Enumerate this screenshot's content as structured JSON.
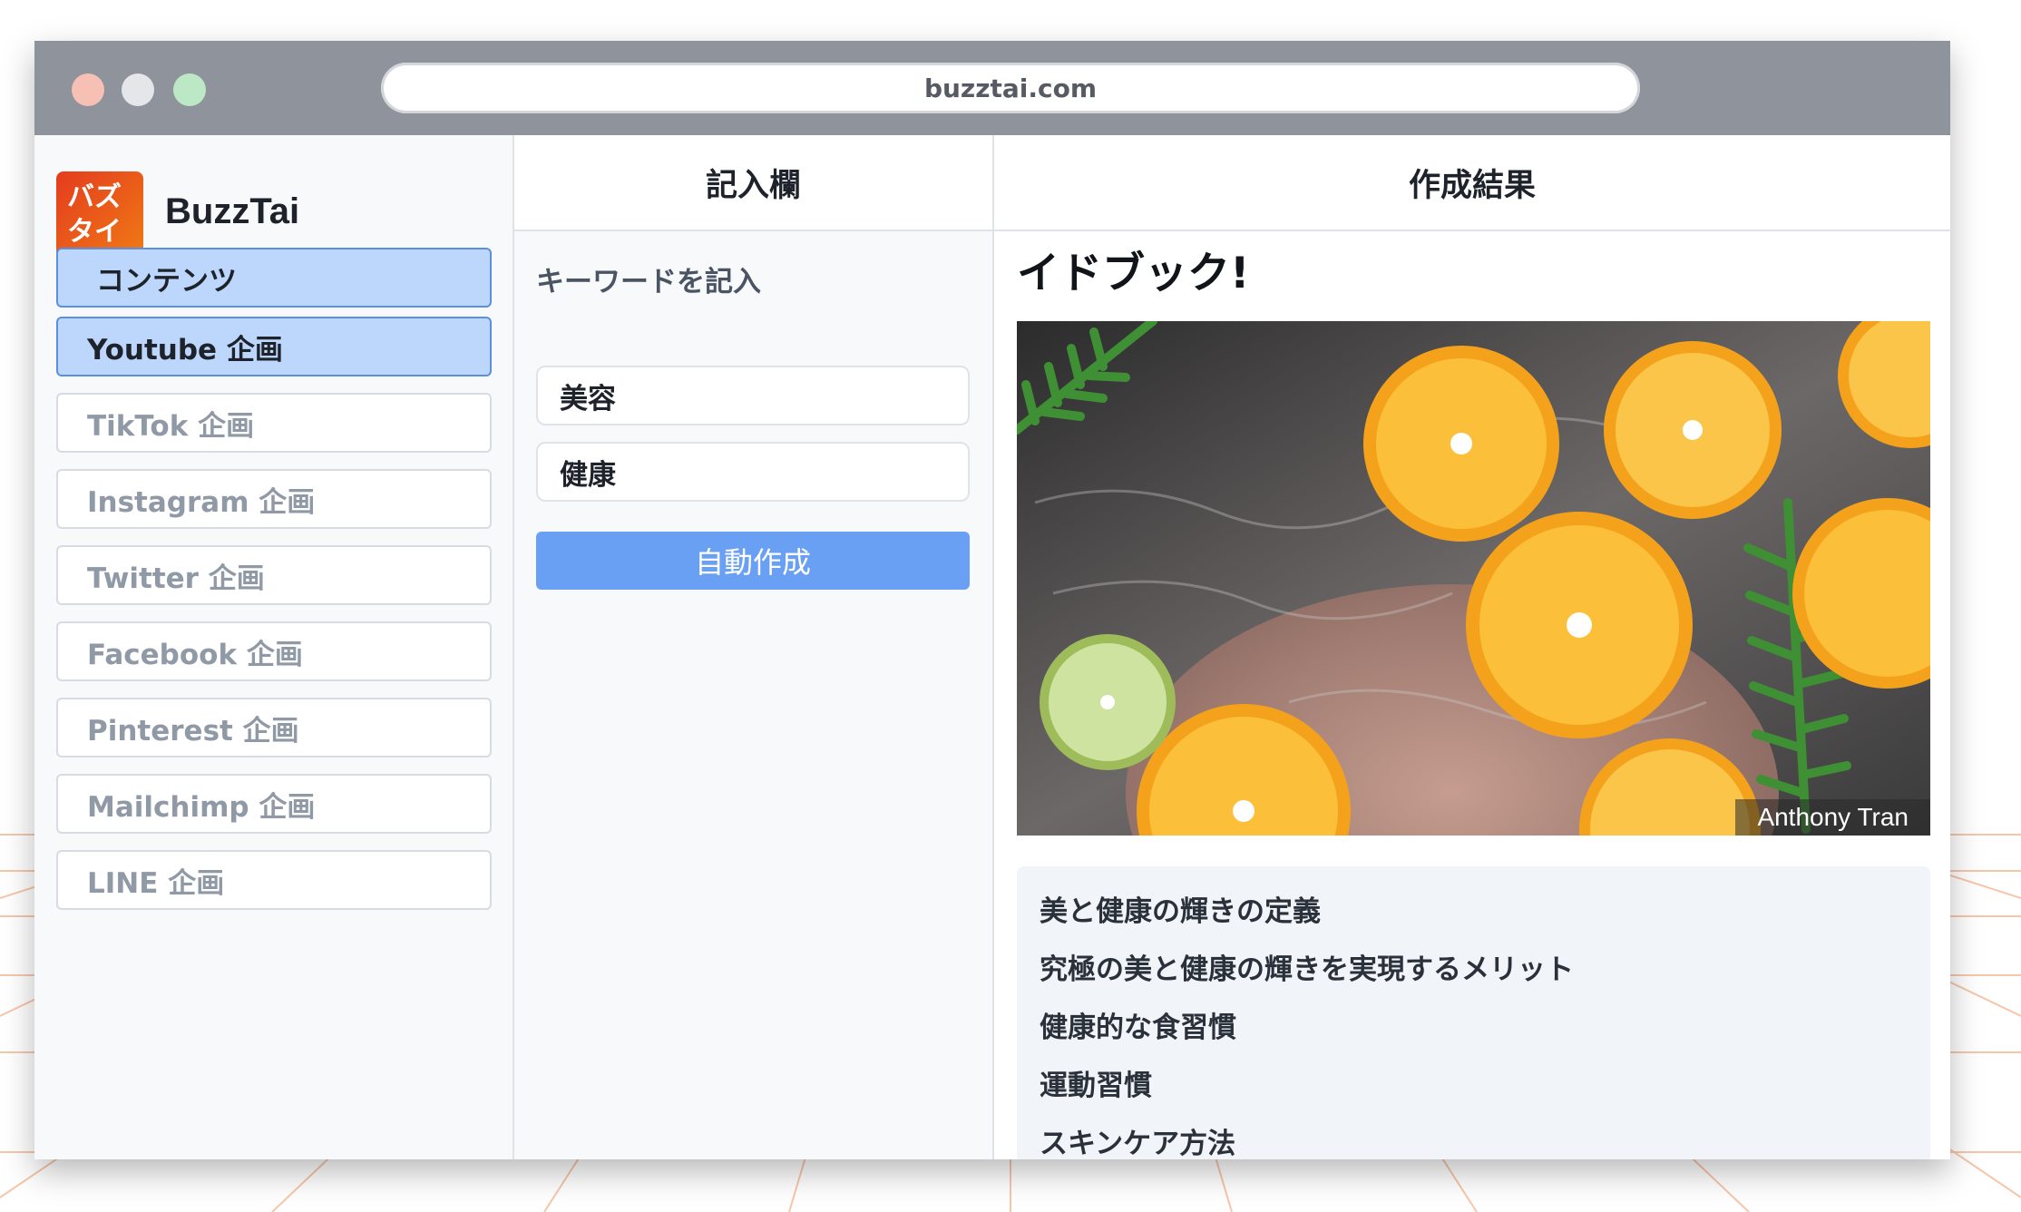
{
  "browser": {
    "url": "buzztai.com"
  },
  "sidebar": {
    "logo_line1": "バズ",
    "logo_line2": "タイ",
    "brand": "BuzzTai",
    "contents_label": "コンテンツ",
    "items": [
      {
        "label": "Youtube 企画",
        "active": true
      },
      {
        "label": "TikTok 企画",
        "active": false
      },
      {
        "label": "Instagram 企画",
        "active": false
      },
      {
        "label": "Twitter 企画",
        "active": false
      },
      {
        "label": "Facebook 企画",
        "active": false
      },
      {
        "label": "Pinterest 企画",
        "active": false
      },
      {
        "label": "Mailchimp 企画",
        "active": false
      },
      {
        "label": "LINE 企画",
        "active": false
      }
    ]
  },
  "input_panel": {
    "header": "記入欄",
    "keyword_label": "キーワードを記入",
    "keyword1": "美容",
    "keyword2": "健康",
    "generate_button": "自動作成"
  },
  "result_panel": {
    "header": "作成結果",
    "title": "イドブック!",
    "photo_credit": "Anthony Tran",
    "outline": [
      "美と健康の輝きの定義",
      "究極の美と健康の輝きを実現するメリット",
      "健康的な食習慣",
      "運動習慣",
      "スキンケア方法"
    ]
  },
  "colors": {
    "accent": "#6aa0f3",
    "active_nav_bg": "#bcd7fb",
    "active_nav_border": "#5d8fe0",
    "logo_gradient": [
      "#e43c1e",
      "#f07a15"
    ],
    "titlebar": "#8e939c"
  }
}
